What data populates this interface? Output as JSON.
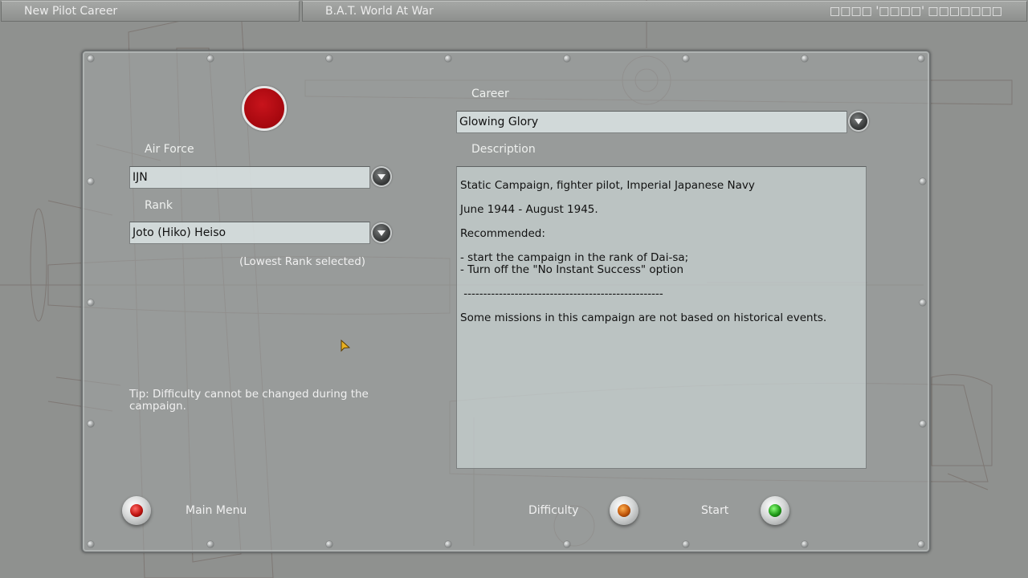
{
  "header": {
    "screen_title": "New Pilot Career",
    "game_title": "B.A.T. World At War",
    "pilot_indicator": "□□□□ '□□□□' □□□□□□□"
  },
  "form": {
    "air_force_label": "Air Force",
    "air_force_value": "IJN",
    "rank_label": "Rank",
    "rank_value": "Joto (Hiko) Heiso",
    "rank_note": "(Lowest Rank selected)",
    "career_label": "Career",
    "career_value": "Glowing Glory",
    "description_label": "Description",
    "tip": "Tip: Difficulty cannot be changed during the campaign."
  },
  "description": {
    "line1": "Static Campaign, fighter pilot, Imperial Japanese Navy",
    "line2": "June 1944 - August 1945.",
    "line3": "Recommended:",
    "line4": "- start the campaign in the rank of Dai-sa;\n- Turn off the \"No Instant Success\" option",
    "line5": " ---------------------------------------------------",
    "line6": "Some missions in this campaign are not based on historical events."
  },
  "buttons": {
    "main_menu": "Main Menu",
    "difficulty": "Difficulty",
    "start": "Start"
  },
  "colors": {
    "background": "#8f918f",
    "emblem_red": "#a5070e",
    "lamp_red": "#c01410",
    "lamp_orange": "#c0560a",
    "lamp_green": "#1f9a18"
  },
  "icons": {
    "dropdown": "chevron-down-icon",
    "cursor": "mouse-cursor-icon"
  }
}
